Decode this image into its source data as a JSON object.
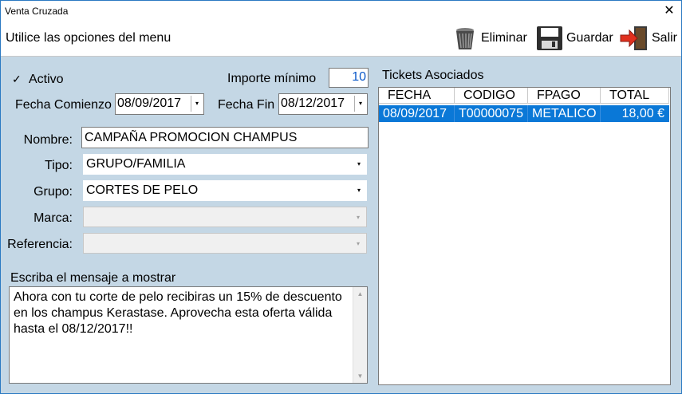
{
  "window": {
    "title": "Venta Cruzada",
    "close_glyph": "✕"
  },
  "toolbar": {
    "hint": "Utilice las opciones del menu",
    "delete_label": "Eliminar",
    "save_label": "Guardar",
    "exit_label": "Salir"
  },
  "form": {
    "active_label": "Activo",
    "active_checked": true,
    "check_glyph": "✓",
    "min_amount_label": "Importe mínimo",
    "min_amount_value": "10",
    "start_date_label": "Fecha Comienzo",
    "start_date_value": "08/09/2017",
    "end_date_label": "Fecha Fin",
    "end_date_value": "08/12/2017",
    "name_label": "Nombre:",
    "name_value": "CAMPAÑA PROMOCION CHAMPUS",
    "type_label": "Tipo:",
    "type_value": "GRUPO/FAMILIA",
    "group_label": "Grupo:",
    "group_value": "CORTES DE PELO",
    "brand_label": "Marca:",
    "brand_value": "",
    "reference_label": "Referencia:",
    "reference_value": "",
    "message_label": "Escriba el mensaje a mostrar",
    "message_lines": [
      "Ahora con tu corte de pelo recibiras un 15% de descuento",
      "en los champus Kerastase. Aprovecha esta oferta válida",
      "hasta el 08/12/2017!!"
    ],
    "dropdown_glyph": "▾",
    "up_glyph": "▲",
    "down_glyph": "▼"
  },
  "tickets": {
    "title": "Tickets Asociados",
    "columns": [
      "FECHA",
      "CODIGO",
      "FPAGO",
      "TOTAL"
    ],
    "rows": [
      [
        "08/09/2017",
        "T00000075",
        "METALICO",
        "18,00 €"
      ]
    ]
  },
  "colors": {
    "panel_bg": "#c4d7e5",
    "selection": "#0a78d7",
    "window_border": "#2b79c2"
  }
}
